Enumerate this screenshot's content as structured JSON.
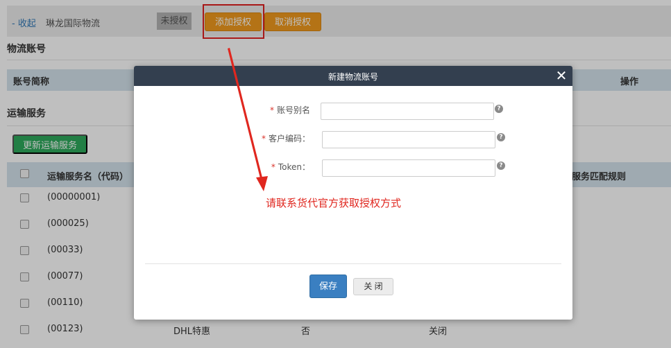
{
  "topbar": {
    "collapse_label": "- 收起",
    "company_name": "琳龙国际物流",
    "status_tag": "未授权",
    "add_auth_label": "添加授权",
    "cancel_auth_label": "取消授权"
  },
  "accounts_section": {
    "title": "物流账号",
    "col_name": "账号简称",
    "col_op": "操作"
  },
  "services_section": {
    "title": "运输服务",
    "update_button": "更新运输服务",
    "col_name": "运输服务名（代码）",
    "col_rule": "服务匹配规则",
    "rows": [
      {
        "code": "(00000001)",
        "carrier": "",
        "flag": "",
        "state": ""
      },
      {
        "code": "(000025)",
        "carrier": "",
        "flag": "",
        "state": ""
      },
      {
        "code": "(00033)",
        "carrier": "",
        "flag": "",
        "state": ""
      },
      {
        "code": "(00077)",
        "carrier": "",
        "flag": "",
        "state": ""
      },
      {
        "code": "(00110)",
        "carrier": "",
        "flag": "",
        "state": ""
      },
      {
        "code": "(00123)",
        "carrier": "DHL特惠",
        "flag": "否",
        "state": "关闭"
      }
    ]
  },
  "modal": {
    "title": "新建物流账号",
    "close_glyph": "✕",
    "fields": [
      {
        "required_mark": "*",
        "label": "账号别名",
        "value": "",
        "placeholder": ""
      },
      {
        "required_mark": "*",
        "label": "客户编码：",
        "value": "",
        "placeholder": ""
      },
      {
        "required_mark": "*",
        "label": "Token：",
        "value": "",
        "placeholder": ""
      }
    ],
    "help_glyph": "?",
    "save_label": "保存",
    "close_label": "关 闭"
  },
  "annotation": {
    "text": "请联系货代官方获取授权方式",
    "color": "#e0271f"
  },
  "icons": {
    "close": "close-icon",
    "help": "help-icon",
    "arrow": "arrow-annotation-icon"
  },
  "colors": {
    "orange_button": "#f09a1e",
    "green_button": "#2eaa5c",
    "primary_button": "#3a7fc1",
    "modal_header": "#333f4f",
    "table_header": "#d4e3ec",
    "highlight": "#e02020"
  }
}
